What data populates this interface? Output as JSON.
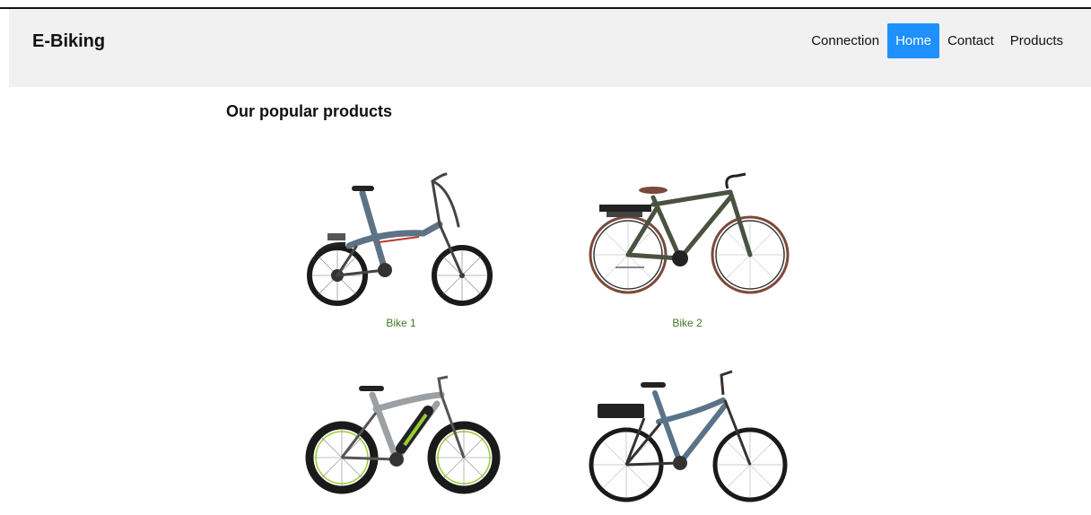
{
  "header": {
    "brand": "E-Biking",
    "nav": [
      {
        "label": "Connection",
        "active": false
      },
      {
        "label": "Home",
        "active": true
      },
      {
        "label": "Contact",
        "active": false
      },
      {
        "label": "Products",
        "active": false
      }
    ],
    "accent_color": "#1e90ff"
  },
  "main": {
    "title": "Our popular products",
    "products": [
      {
        "label": "Bike 1",
        "image": "folding-ebike-image"
      },
      {
        "label": "Bike 2",
        "image": "city-ebike-image"
      },
      {
        "label": "",
        "image": "mountain-ebike-image"
      },
      {
        "label": "",
        "image": "touring-ebike-image"
      }
    ],
    "caption_color": "#3d7a22"
  }
}
